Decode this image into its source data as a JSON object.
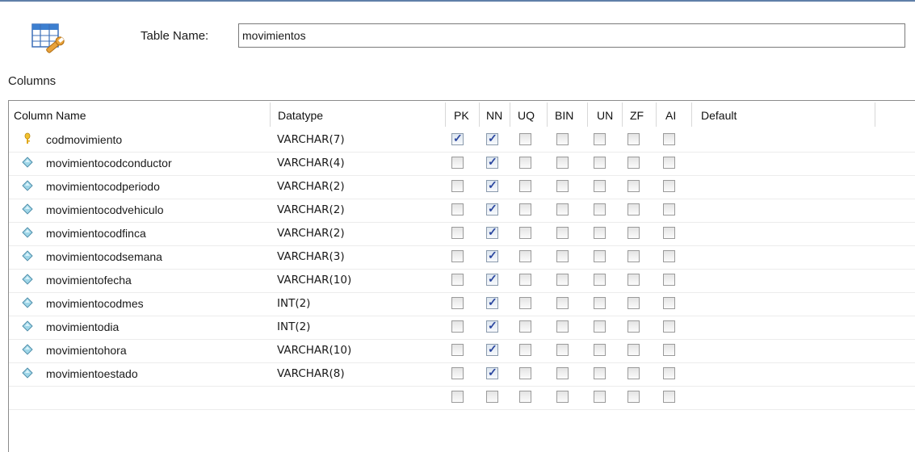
{
  "window": {
    "accent": "#5f7fa8"
  },
  "table_name": {
    "label": "Table Name:",
    "value": "movimientos"
  },
  "columns_section": {
    "label": "Columns"
  },
  "grid": {
    "headers": [
      "Column Name",
      "Datatype",
      "PK",
      "NN",
      "UQ",
      "BIN",
      "UN",
      "ZF",
      "AI",
      "Default"
    ],
    "flag_keys": [
      "PK",
      "NN",
      "UQ",
      "BIN",
      "UN",
      "ZF",
      "AI"
    ],
    "rows": [
      {
        "icon": "primary-key-icon",
        "name": "codmovimiento",
        "datatype": "VARCHAR(7)",
        "flags": [
          true,
          true,
          false,
          false,
          false,
          false,
          false
        ]
      },
      {
        "icon": "column-diamond-icon",
        "name": "movimientocodconductor",
        "datatype": "VARCHAR(4)",
        "flags": [
          false,
          true,
          false,
          false,
          false,
          false,
          false
        ]
      },
      {
        "icon": "column-diamond-icon",
        "name": "movimientocodperiodo",
        "datatype": "VARCHAR(2)",
        "flags": [
          false,
          true,
          false,
          false,
          false,
          false,
          false
        ]
      },
      {
        "icon": "column-diamond-icon",
        "name": "movimientocodvehiculo",
        "datatype": "VARCHAR(2)",
        "flags": [
          false,
          true,
          false,
          false,
          false,
          false,
          false
        ]
      },
      {
        "icon": "column-diamond-icon",
        "name": "movimientocodfinca",
        "datatype": "VARCHAR(2)",
        "flags": [
          false,
          true,
          false,
          false,
          false,
          false,
          false
        ]
      },
      {
        "icon": "column-diamond-icon",
        "name": "movimientocodsemana",
        "datatype": "VARCHAR(3)",
        "flags": [
          false,
          true,
          false,
          false,
          false,
          false,
          false
        ]
      },
      {
        "icon": "column-diamond-icon",
        "name": "movimientofecha",
        "datatype": "VARCHAR(10)",
        "flags": [
          false,
          true,
          false,
          false,
          false,
          false,
          false
        ]
      },
      {
        "icon": "column-diamond-icon",
        "name": "movimientocodmes",
        "datatype": "INT(2)",
        "flags": [
          false,
          true,
          false,
          false,
          false,
          false,
          false
        ]
      },
      {
        "icon": "column-diamond-icon",
        "name": "movimientodia",
        "datatype": "INT(2)",
        "flags": [
          false,
          true,
          false,
          false,
          false,
          false,
          false
        ]
      },
      {
        "icon": "column-diamond-icon",
        "name": "movimientohora",
        "datatype": "VARCHAR(10)",
        "flags": [
          false,
          true,
          false,
          false,
          false,
          false,
          false
        ]
      },
      {
        "icon": "column-diamond-icon",
        "name": "movimientoestado",
        "datatype": "VARCHAR(8)",
        "flags": [
          false,
          true,
          false,
          false,
          false,
          false,
          false
        ]
      },
      {
        "icon": "",
        "name": "",
        "datatype": "",
        "flags": [
          false,
          false,
          false,
          false,
          false,
          false,
          false
        ]
      }
    ]
  }
}
